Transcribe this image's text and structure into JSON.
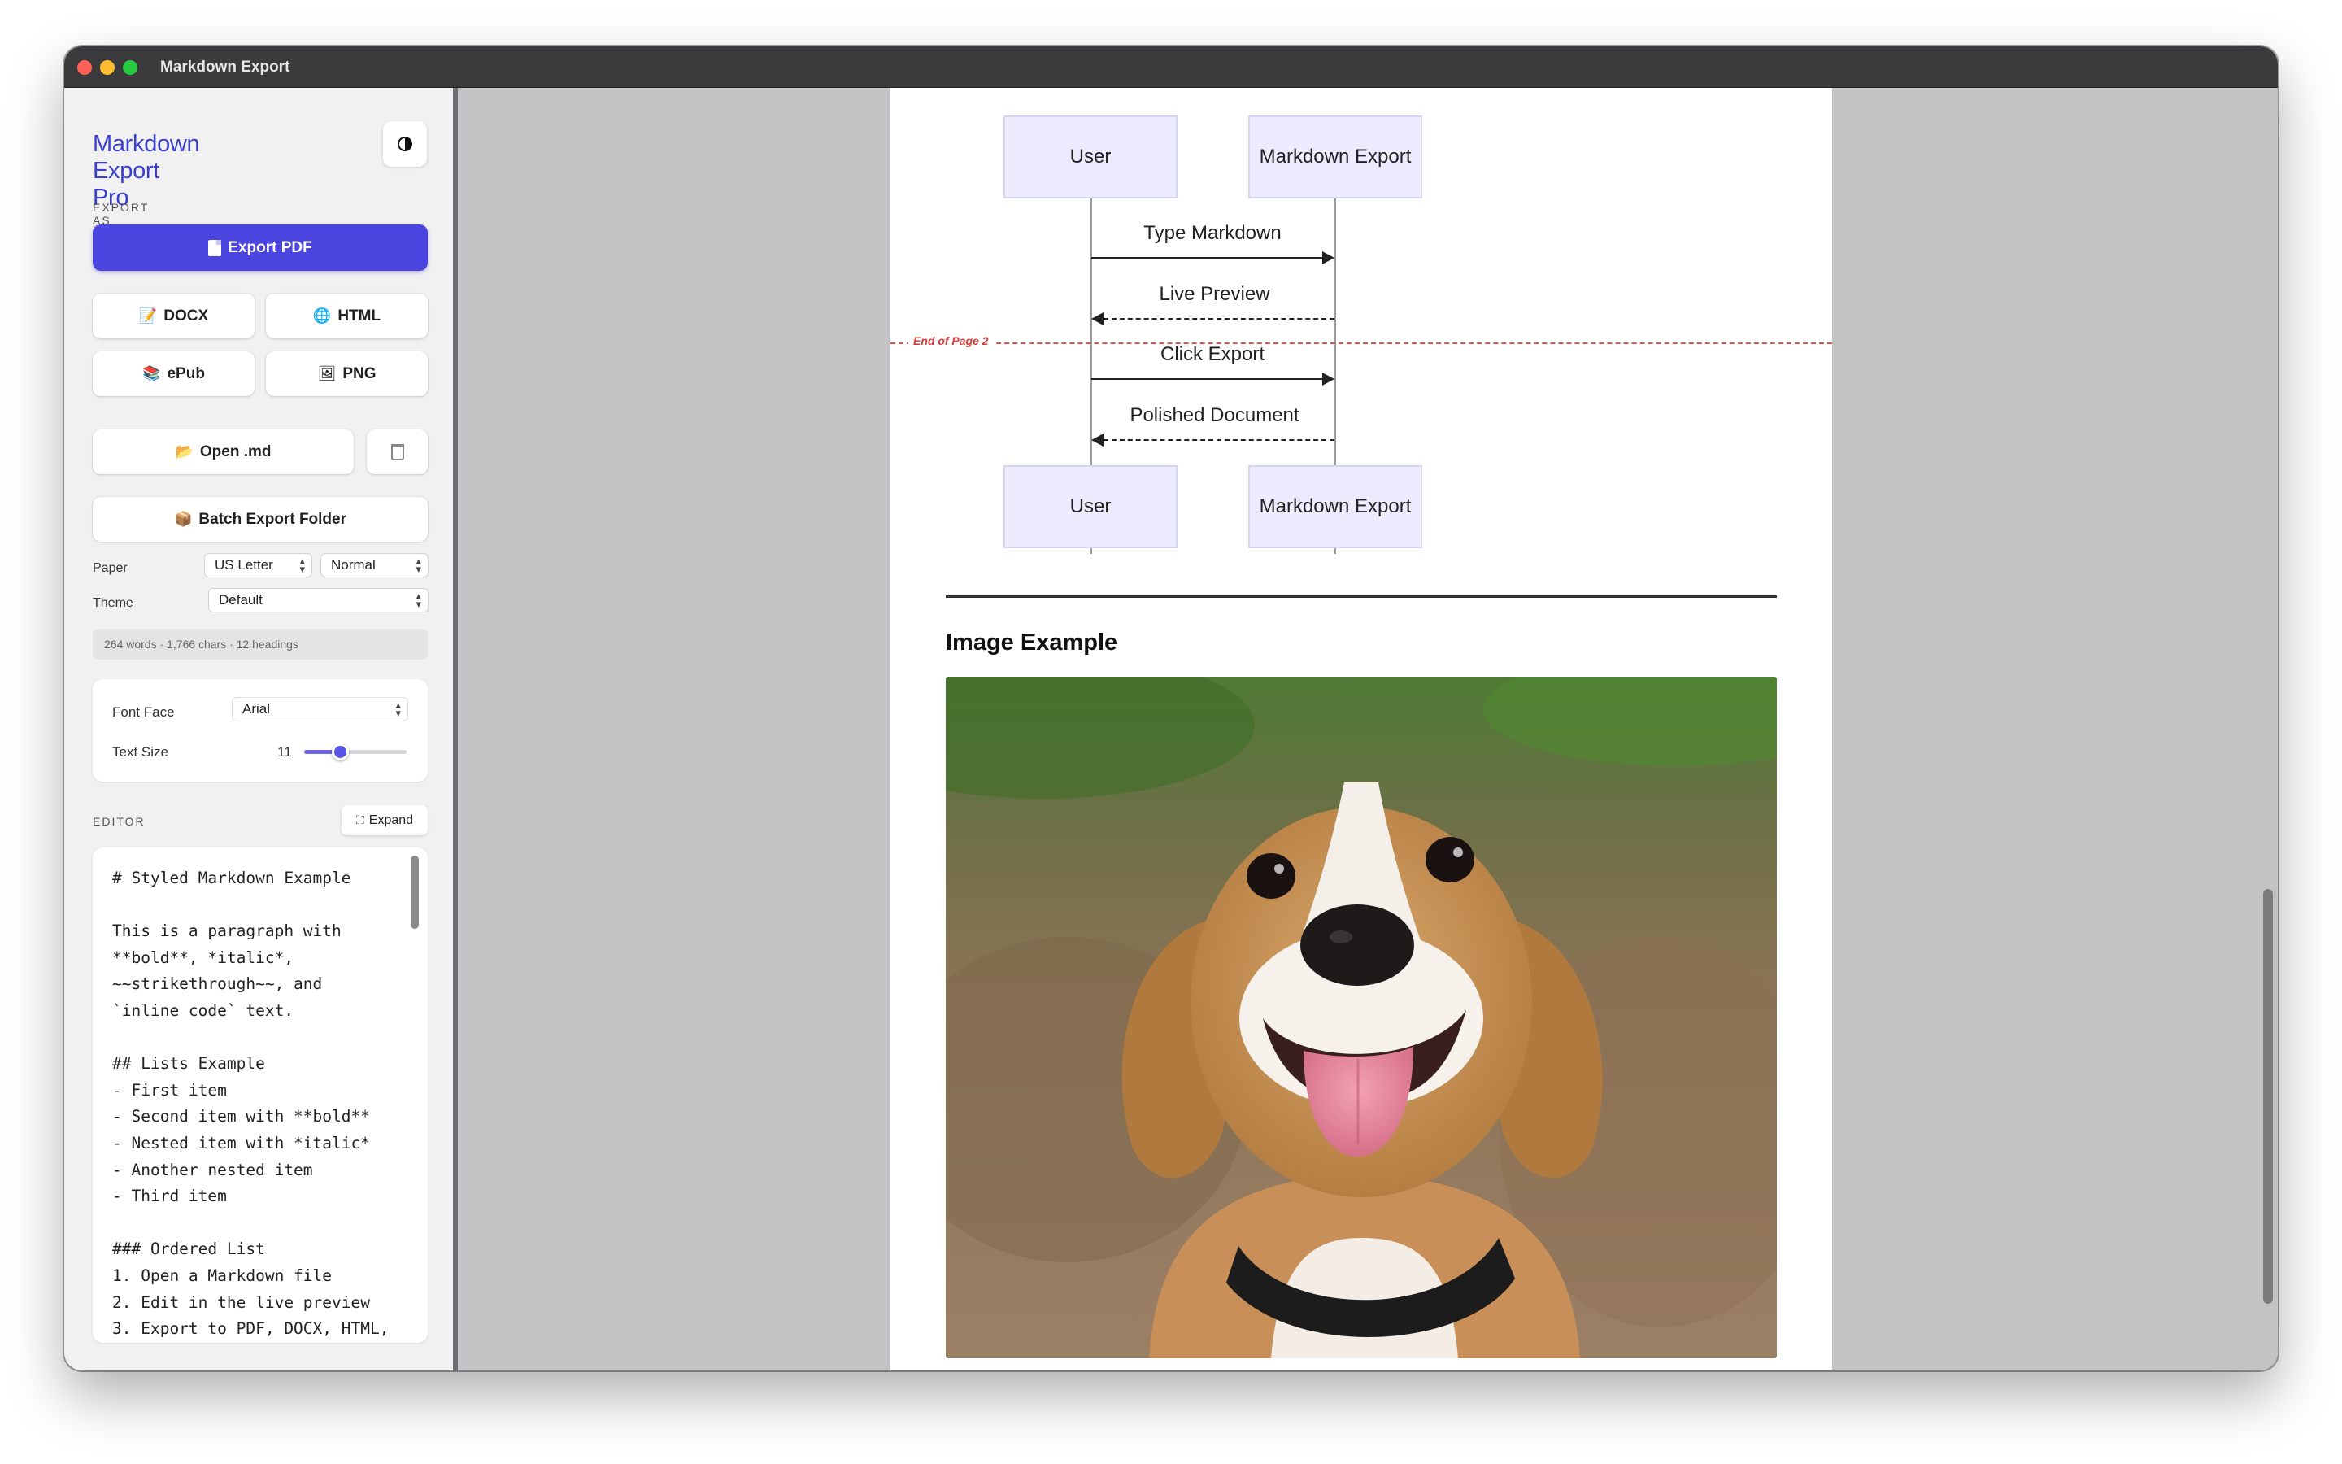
{
  "window": {
    "title": "Markdown Export"
  },
  "sidebar": {
    "app_title": "Markdown Export Pro",
    "theme_toggle_icon": "contrast-icon",
    "export_section_label": "EXPORT AS",
    "export_pdf": "Export PDF",
    "docx": "DOCX",
    "html": "HTML",
    "epub": "ePub",
    "png": "PNG",
    "open_md": "Open .md",
    "batch_export": "Batch Export Folder",
    "paper_label": "Paper",
    "paper_size": "US Letter",
    "paper_margin": "Normal",
    "theme_label": "Theme",
    "theme_value": "Default",
    "stats": "264 words · 1,766 chars · 12 headings",
    "font_face_label": "Font Face",
    "font_face_value": "Arial",
    "text_size_label": "Text Size",
    "text_size_value": "11",
    "text_size_slider_fraction": 0.35,
    "editor_section_label": "EDITOR",
    "expand": "Expand",
    "editor_content": "# Styled Markdown Example\n\nThis is a paragraph with\n**bold**, *italic*,\n~~strikethrough~~, and\n`inline code` text.\n\n## Lists Example\n- First item\n- Second item with **bold**\n- Nested item with *italic*\n- Another nested item\n- Third item\n\n### Ordered List\n1. Open a Markdown file\n2. Edit in the live preview\n3. Export to PDF, DOCX, HTML,"
  },
  "preview": {
    "diagram": {
      "participant_a": "User",
      "participant_b": "Markdown Export",
      "participant_a_bottom": "User",
      "participant_b_bottom": "Markdown Export",
      "messages": [
        "Type Markdown",
        "Live Preview",
        "Click Export",
        "Polished Document"
      ]
    },
    "page_break_label": "End of Page 2",
    "image_heading": "Image Example"
  },
  "colors": {
    "accent": "#4b45e0",
    "page_break": "#e05151",
    "participant_fill": "#ececfe"
  }
}
